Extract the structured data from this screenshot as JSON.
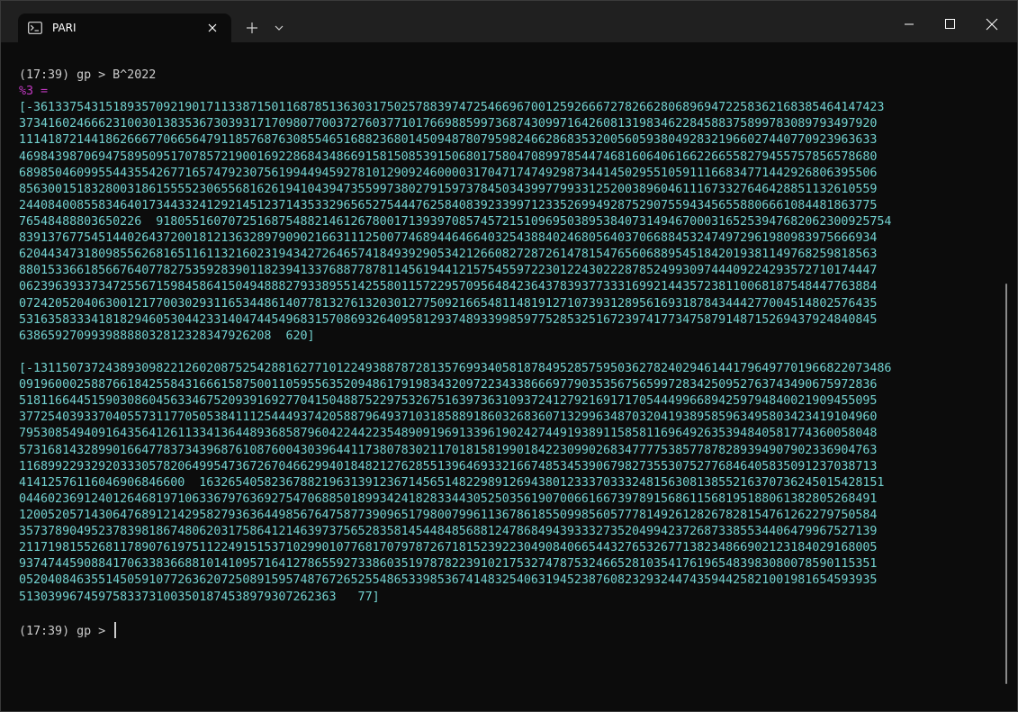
{
  "titlebar": {
    "tab_title": "PARI",
    "tab_icon": "terminal-icon",
    "new_tab_icon": "plus-icon",
    "dropdown_icon": "chevron-down-icon",
    "minimize_icon": "minimize-icon",
    "maximize_icon": "maximize-icon",
    "close_icon": "close-icon"
  },
  "terminal": {
    "prompt_text": "(17:39) gp > B^2022",
    "result_label": "%3 =",
    "first_value_lines": [
      "[-3613375431518935709219017113387150116878513630317502578839747254669670012592666727826628068969472258362168385464147423",
      "37341602466623100301383536730393171709807700372760377101766988599736874309971642608131983462284588375899783089793497920",
      "11141872144186266677066564791185768763085546516882368014509487807959824662868353200560593804928321966027440770923963633",
      "46984398706947589509517078572190016922868434866915815085391506801758047089978544746816064061662266558279455757856578680",
      "68985046099554435542677165747923075619944945927810129092460000317047174749298734414502955105911166834771442926806395506",
      "85630015183280031861555523065568162619410439473559973802791597378450343997799331252003896046111673327646428851132610559",
      "24408400855834640173443324129214512371435332965652754447625840839233997123352699492875290755943456558806661084481863775",
      "76548488803650226  918055160707251687548821461267800171393970857457215109695038953840731494670003165253947682062300925754",
      "83913767754514402643720018121363289790902166311125007746894464664032543884024680564037066884532474972961980983975666934",
      "62044347318098556268165116113216023194342726465741849392905342126608272872614781547656068895451842019381149768259818563",
      "88015336618566764077827535928390118239413376887787811456194412157545597223012243022287852499309744409224293572710174447",
      "06239639337347255671598458641504948882793389551425580115722957095648423643783937733316992144357238110068187548447763884",
      "07242052040630012177003029311653448614077813276132030127750921665481148191271073931289561693187843444277004514802576435",
      "53163583334181829460530442331404744549683157086932640958129374893399859775285325167239741773475879148715269437924840845",
      "63865927099398888032812328347926208  620]"
    ],
    "second_value_lines": [
      "[-13115073724389309822126020875254288162771012249388787281357699340581878495285759503627824029461441796497701966822073486",
      "09196000258876618425584316661587500110595563520948617919834320972234338666977903535675659972834250952763743490675972836",
      "51811664451590308604563346752093916927704150488752297532675163973631093724127921691717054449966894259794840021909455095",
      "37725403933704055731177050538411125444937420588796493710318588918603268360713299634870320419389585963495803423419104960",
      "79530854940916435641261133413644893685879604224422354890919691339619024274491938911585811696492635394840581774360058048",
      "57316814328990166477837343968761087600430396441173807830211701815819901842230990268347777538577878289394907902336904763",
      "11689922932920333057820649954736726704662994018482127628551396469332166748534539067982735530752776846405835091237038713",
      "41412576116046906846600  16326540582367882196313912367145651482298912694380123337033324815630813855216370736245015428151",
      "04460236912401264681971063367976369275470688501899342418283344305250356190700661667397891568611568195188061382805268491",
      "12005205714306476891214295827936364498567647587739096517980079961136786185509985605777814926128267828154761262279750584",
      "35737890495237839818674806203175864121463973756528358145448485688124786849439333273520499423726873385534406479967527139",
      "21171981552681178907619751122491515371029901077681707978726718152392230490840665443276532677138234866902123184029168005",
      "93747445908841706338366881014109571641278655927338603519787822391021753274787532466528103541761965483983080078590115351",
      "05204084635514505910772636207250891595748767265255486533985367414832540631945238760823293244743594425821001981654593935",
      "51303996745975833731003501874538979307262363   77]"
    ],
    "final_prompt": "(17:39) gp > "
  },
  "colors": {
    "background": "#0c0c0c",
    "titlebar": "#202020",
    "prompt": "#cccccc",
    "label": "#c239c2",
    "output": "#72d2d0"
  }
}
